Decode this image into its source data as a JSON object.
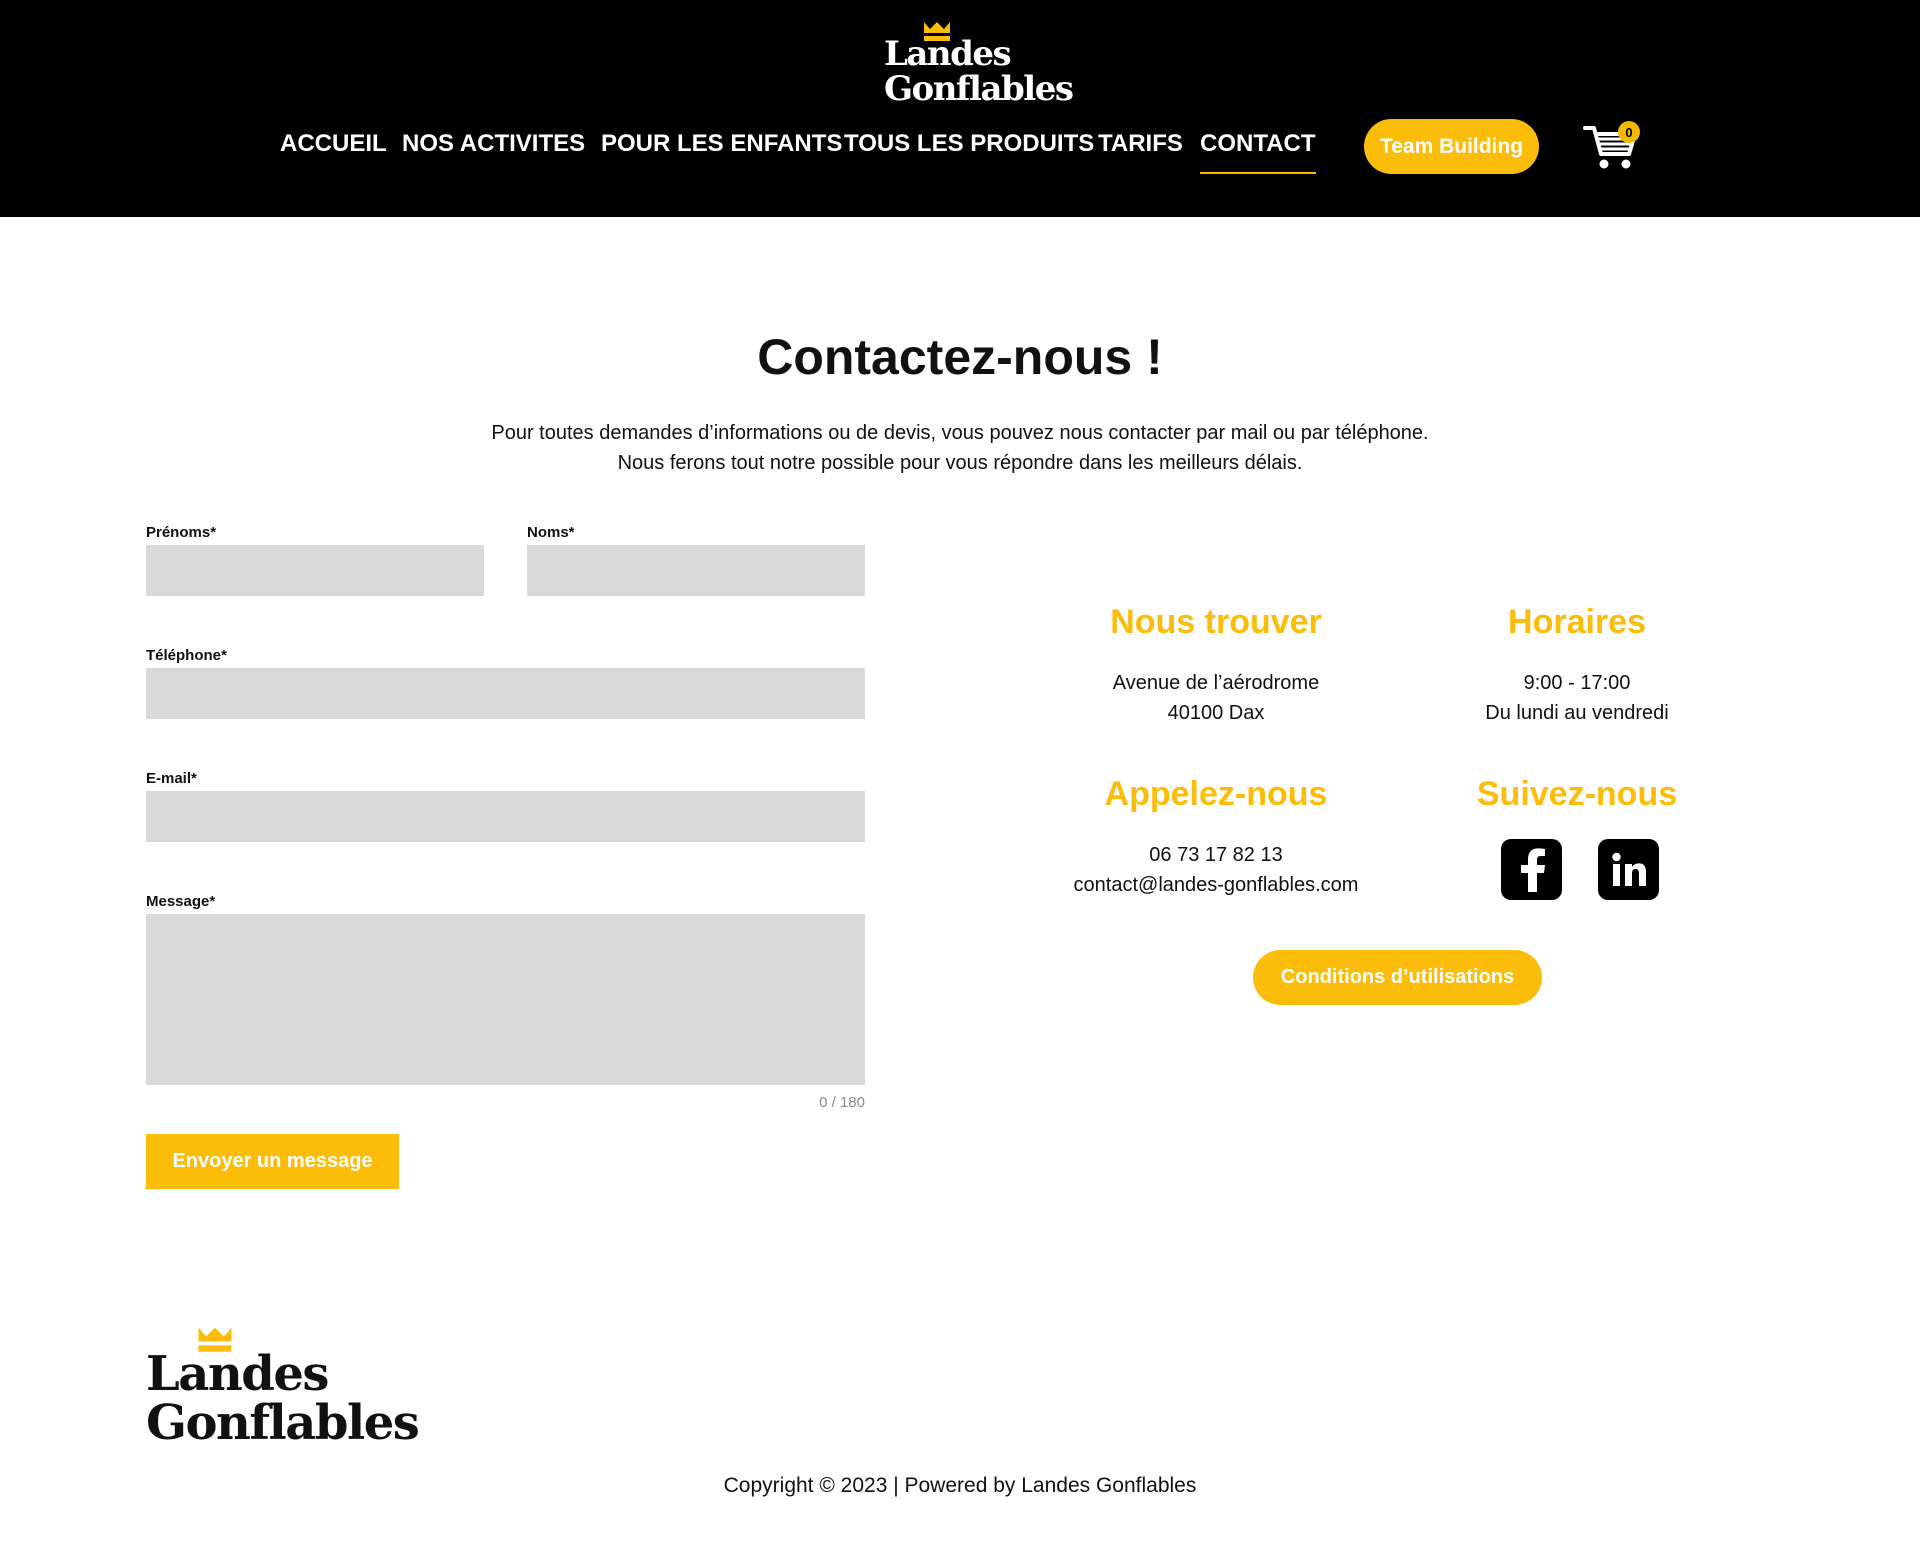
{
  "header": {
    "logo": {
      "line1": "Landes",
      "line2": "Gonflables"
    },
    "nav": [
      {
        "label": "ACCUEIL"
      },
      {
        "label": "NOS ACTIVITES"
      },
      {
        "label": "POUR LES ENFANTS"
      },
      {
        "label": "TOUS LES PRODUITS"
      },
      {
        "label": "TARIFS"
      },
      {
        "label": "CONTACT",
        "active": true
      }
    ],
    "team_button": "Team Building",
    "cart_count": "0"
  },
  "main": {
    "title": "Contactez-nous !",
    "intro_line1": "Pour toutes demandes d’informations ou de devis, vous pouvez nous contacter par mail ou par téléphone.",
    "intro_line2": "Nous ferons tout notre possible pour vous répondre dans les meilleurs délais."
  },
  "form": {
    "first_name_label": "Prénoms*",
    "last_name_label": "Noms*",
    "phone_label": "Téléphone*",
    "email_label": "E-mail*",
    "message_label": "Message*",
    "counter": "0 / 180",
    "submit_label": "Envoyer un message"
  },
  "info": {
    "find_title": "Nous trouver",
    "address_line1": "Avenue de l’aérodrome",
    "address_line2": "40100 Dax",
    "hours_title": "Horaires",
    "hours_line1": "9:00 - 17:00",
    "hours_line2": "Du lundi au vendredi",
    "call_title": "Appelez-nous",
    "phone": "06 73 17 82 13",
    "email": "contact@landes-gonflables.com",
    "follow_title": "Suivez-nous",
    "social": [
      "facebook-icon",
      "linkedin-icon"
    ],
    "conditions_button": "Conditions d’utilisations"
  },
  "footer": {
    "logo": {
      "line1": "Landes",
      "line2": "Gonflables"
    },
    "copyright": "Copyright © 2023 | Powered by Landes Gonflables"
  },
  "colors": {
    "accent": "#fbbd0a",
    "header_bg": "#000000",
    "field_bg": "#d9d9d9"
  }
}
